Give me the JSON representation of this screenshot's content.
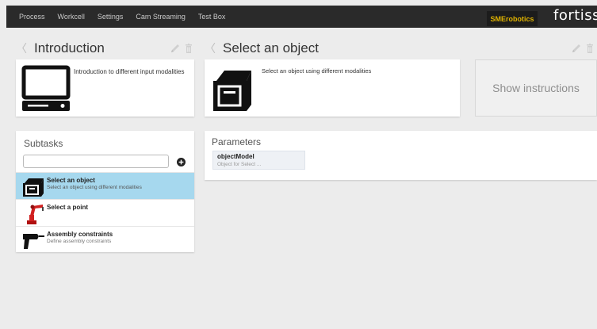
{
  "nav": {
    "items": [
      "Process",
      "Workcell",
      "Settings",
      "Cam Streaming",
      "Test Box"
    ],
    "brand_sme": "SMErobotics",
    "brand_fortiss": "fortiss"
  },
  "left": {
    "title": "Introduction",
    "card_text": "Introduction to different input modalities",
    "card_icon": "computer-icon"
  },
  "subtasks": {
    "title": "Subtasks",
    "search_value": "",
    "items": [
      {
        "title": "Select an object",
        "subtitle": "Select an object using different modalities",
        "icon": "box-icon",
        "active": true
      },
      {
        "title": "Select a point",
        "subtitle": "",
        "icon": "robot-arm-icon",
        "active": false
      },
      {
        "title": "Assembly constraints",
        "subtitle": "Define assembly constraints",
        "icon": "drill-icon",
        "active": false
      }
    ]
  },
  "main": {
    "title": "Select an object",
    "card_text": "Select an object using different modalities",
    "card_icon": "box-icon",
    "instructions_label": "Show instructions"
  },
  "parameters": {
    "title": "Parameters",
    "items": [
      {
        "name": "objectModel",
        "subtitle": "Object for Select ..."
      }
    ]
  },
  "colors": {
    "topbar": "#2a2a2a",
    "active_row": "#a6d8ee",
    "brand_accent": "#e0b300"
  }
}
